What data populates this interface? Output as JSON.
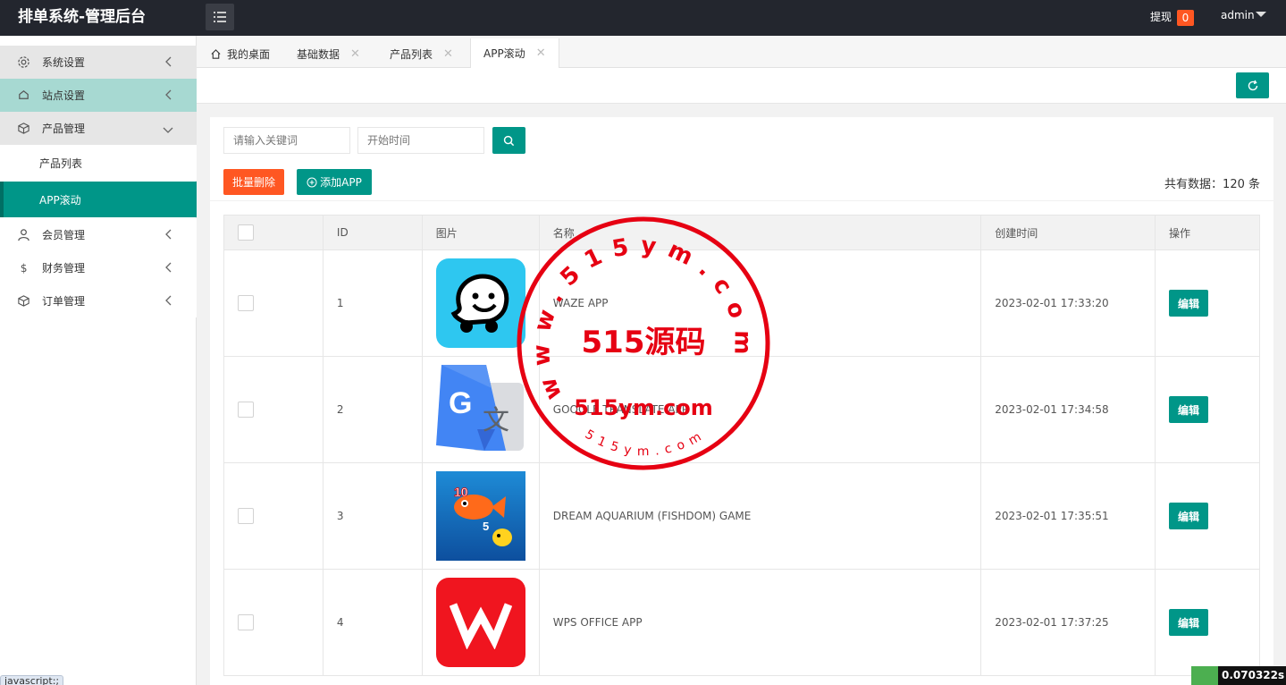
{
  "header": {
    "brand": "排单系统-管理后台",
    "withdraw_label": "提现",
    "withdraw_count": "0",
    "user": "admin"
  },
  "sidebar": {
    "items": [
      {
        "label": "系统设置"
      },
      {
        "label": "站点设置"
      },
      {
        "label": "产品管理"
      },
      {
        "label": "产品列表"
      },
      {
        "label": "APP滚动"
      },
      {
        "label": "会员管理"
      },
      {
        "label": "财务管理"
      },
      {
        "label": "订单管理"
      }
    ]
  },
  "tabs": [
    {
      "label": "我的桌面"
    },
    {
      "label": "基础数据"
    },
    {
      "label": "产品列表"
    },
    {
      "label": "APP滚动"
    }
  ],
  "search": {
    "keyword_placeholder": "请输入关键词",
    "date_placeholder": "开始时间"
  },
  "actions": {
    "batch_delete": "批量删除",
    "add_app": "添加APP",
    "total": "共有数据：120 条"
  },
  "table": {
    "headers": [
      "ID",
      "图片",
      "名称",
      "创建时间",
      "操作"
    ],
    "edit_label": "编辑",
    "rows": [
      {
        "id": "1",
        "name": "WAZE APP",
        "created": "2023-02-01 17:33:20",
        "icon": "waze-icon"
      },
      {
        "id": "2",
        "name": "GOOGLE TRANSLATE APP",
        "created": "2023-02-01 17:34:58",
        "icon": "google-translate-icon"
      },
      {
        "id": "3",
        "name": "DREAM AQUARIUM (FISHDOM) GAME",
        "created": "2023-02-01 17:35:51",
        "icon": "fishdom-icon"
      },
      {
        "id": "4",
        "name": "WPS OFFICE APP",
        "created": "2023-02-01 17:37:25",
        "icon": "wps-icon"
      }
    ]
  },
  "watermark": {
    "ring_text": "www.515ym.com",
    "center_text": "515源码",
    "domain_text": "515ym.com",
    "bottom_text": "515ym.com"
  },
  "statusbar": "javascript:;",
  "timer": "0.070322s",
  "colors": {
    "primary": "#009688",
    "danger": "#ff5722",
    "topbar": "#23262e",
    "stamp": "#e60012"
  }
}
